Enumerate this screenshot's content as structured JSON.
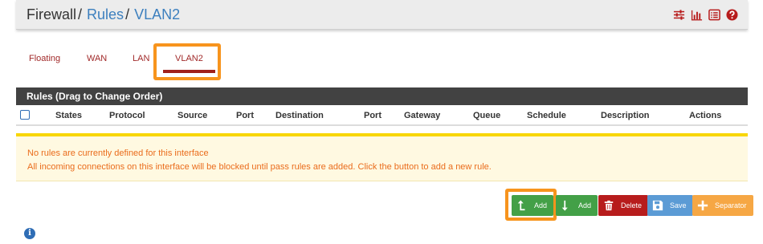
{
  "header": {
    "breadcrumb": [
      "Firewall",
      "Rules",
      "VLAN2"
    ],
    "separator": "/",
    "icons": [
      "sliders-icon",
      "bar-chart-icon",
      "list-icon",
      "help-icon"
    ]
  },
  "tabs": [
    {
      "label": "Floating"
    },
    {
      "label": "WAN"
    },
    {
      "label": "LAN"
    },
    {
      "label": "VLAN2",
      "active": true
    }
  ],
  "table": {
    "title": "Rules (Drag to Change Order)",
    "columns": [
      "States",
      "Protocol",
      "Source",
      "Port",
      "Destination",
      "Port",
      "Gateway",
      "Queue",
      "Schedule",
      "Description",
      "Actions"
    ]
  },
  "warning": {
    "line1": "No rules are currently defined for this interface",
    "line2": "All incoming connections on this interface will be blocked until pass rules are added. Click the button to add a new rule."
  },
  "buttons": {
    "add_top": "Add",
    "add_bottom": "Add",
    "delete": "Delete",
    "save": "Save",
    "separator": "Separator"
  },
  "info_icon": "i",
  "colors": {
    "accent_red": "#a12a2a",
    "highlight": "#f7941d",
    "link_blue": "#3c7fbe",
    "warning_bg": "#fff9e1",
    "warning_text": "#ea6c1c"
  }
}
